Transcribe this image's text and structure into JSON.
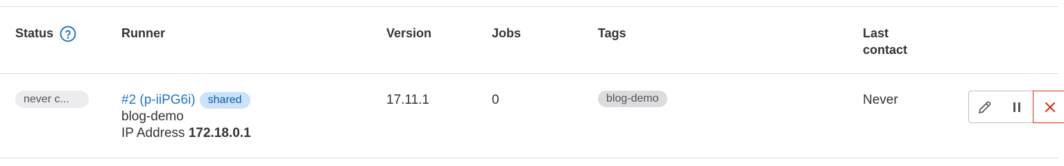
{
  "table": {
    "headers": {
      "status": "Status",
      "runner": "Runner",
      "version": "Version",
      "jobs": "Jobs",
      "tags": "Tags",
      "last_contact_line1": "Last",
      "last_contact_line2": "contact"
    },
    "rows": [
      {
        "status": "never c...",
        "runner_link": "#2 (p-iiPG6i)",
        "runner_type": "shared",
        "description": "blog-demo",
        "ip_label": "IP Address",
        "ip_value": "172.18.0.1",
        "version": "17.11.1",
        "jobs": "0",
        "tags": [
          "blog-demo"
        ],
        "last_contact": "Never"
      }
    ]
  },
  "icons": {
    "help": "question-circle-icon",
    "edit": "pencil-icon",
    "pause": "pause-icon",
    "delete": "close-icon"
  },
  "colors": {
    "link": "#1f75cb",
    "shared_badge_bg": "#cbe2f9",
    "shared_badge_text": "#0b5cad",
    "delete_border": "#dd2b0e",
    "help_icon": "#1f75cb"
  }
}
